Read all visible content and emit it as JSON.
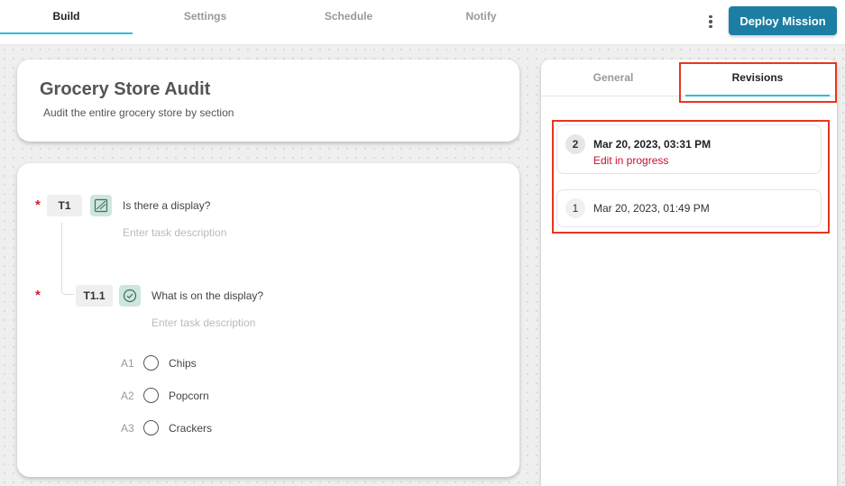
{
  "nav": {
    "tabs": [
      {
        "label": "Build",
        "active": true
      },
      {
        "label": "Settings",
        "active": false
      },
      {
        "label": "Schedule",
        "active": false
      },
      {
        "label": "Notify",
        "active": false
      }
    ],
    "menu_icon": "more-vertical-icon",
    "deploy_label": "Deploy Mission"
  },
  "mission": {
    "title": "Grocery Store Audit",
    "subtitle": "Audit the entire grocery store by section"
  },
  "tasks": [
    {
      "id": "T1",
      "required_mark": "*",
      "type_icon": "image-icon",
      "question": "Is there a display?",
      "description_placeholder": "Enter task description"
    },
    {
      "id": "T1.1",
      "required_mark": "*",
      "type_icon": "check-circle-icon",
      "question": "What is on the display?",
      "description_placeholder": "Enter task description",
      "answers": [
        {
          "code": "A1",
          "label": "Chips"
        },
        {
          "code": "A2",
          "label": "Popcorn"
        },
        {
          "code": "A3",
          "label": "Crackers"
        }
      ]
    }
  ],
  "side_panel": {
    "tabs": [
      {
        "label": "General",
        "active": false
      },
      {
        "label": "Revisions",
        "active": true
      }
    ],
    "revisions": [
      {
        "number": "2",
        "date": "Mar 20, 2023, 03:31 PM",
        "status": "Edit in progress"
      },
      {
        "number": "1",
        "date": "Mar 20, 2023, 01:49 PM",
        "status": ""
      }
    ]
  },
  "colors": {
    "accent": "#2bbfd6",
    "primary_button": "#1c7ea3",
    "required": "#cc1f2f",
    "status_in_progress": "#c8102e",
    "highlight": "#e5371d",
    "icon_bg": "#cfe6df"
  }
}
